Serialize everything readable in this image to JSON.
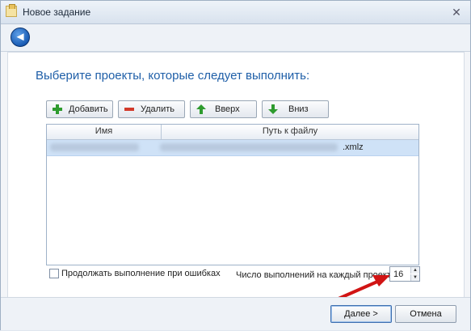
{
  "window": {
    "title": "Новое задание",
    "close_glyph": "✕"
  },
  "nav": {
    "back_icon": "back-arrow-icon"
  },
  "heading": "Выберите проекты, которые следует выполнить:",
  "toolbar_buttons": [
    {
      "label": "Добавить",
      "icon": "plus-icon"
    },
    {
      "label": "Удалить",
      "icon": "minus-icon"
    },
    {
      "label": "Вверх",
      "icon": "up-arrow-icon"
    },
    {
      "label": "Вниз",
      "icon": "down-arrow-icon"
    }
  ],
  "table": {
    "columns": [
      "Имя",
      "Путь к файлу"
    ],
    "rows": [
      {
        "name": "",
        "path_suffix": ".xmlz",
        "selected": true
      }
    ]
  },
  "options": {
    "continue_on_error_label": "Продолжать выполнение при ошибках",
    "continue_on_error_checked": false,
    "runs_per_project_label": "Число выполнений на каждый проект:",
    "runs_per_project_value": "16"
  },
  "footer": {
    "next_label": "Далее >",
    "cancel_label": "Отмена"
  },
  "colors": {
    "heading": "#1f5fa8",
    "selection": "#cfe2f7",
    "annotation_arrow": "#d11414"
  }
}
